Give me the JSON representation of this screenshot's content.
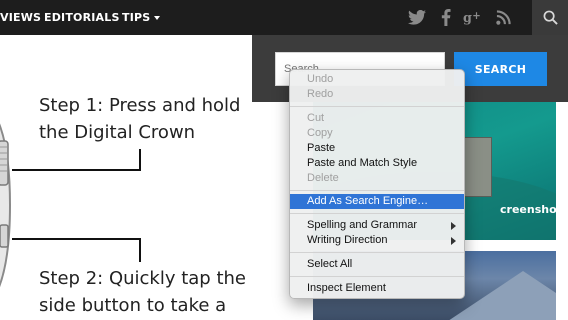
{
  "nav": {
    "items": [
      {
        "label": "VIEWS"
      },
      {
        "label": "EDITORIALS"
      },
      {
        "label": "TIPS"
      }
    ],
    "social_icons": [
      "twitter-icon",
      "facebook-icon",
      "google-plus-icon",
      "rss-icon"
    ],
    "search_icon": "search-icon"
  },
  "search": {
    "placeholder": "Search",
    "button_label": "SEARCH"
  },
  "article": {
    "step1_line1": "Step 1: Press and hold",
    "step1_line2": "the Digital Crown",
    "step2_line1": "Step 2: Quickly tap the",
    "step2_line2": "side button to take a"
  },
  "sidebar": {
    "thumb1_caption": "creenshot"
  },
  "context_menu": {
    "undo": "Undo",
    "redo": "Redo",
    "cut": "Cut",
    "copy": "Copy",
    "paste": "Paste",
    "paste_match": "Paste and Match Style",
    "delete": "Delete",
    "add_engine": "Add As Search Engine…",
    "spelling": "Spelling and Grammar",
    "writing": "Writing Direction",
    "select_all": "Select All",
    "inspect": "Inspect Element"
  },
  "colors": {
    "nav_bg": "#1d1d1d",
    "search_button": "#1e88e5",
    "menu_highlight": "#2f74d6"
  }
}
